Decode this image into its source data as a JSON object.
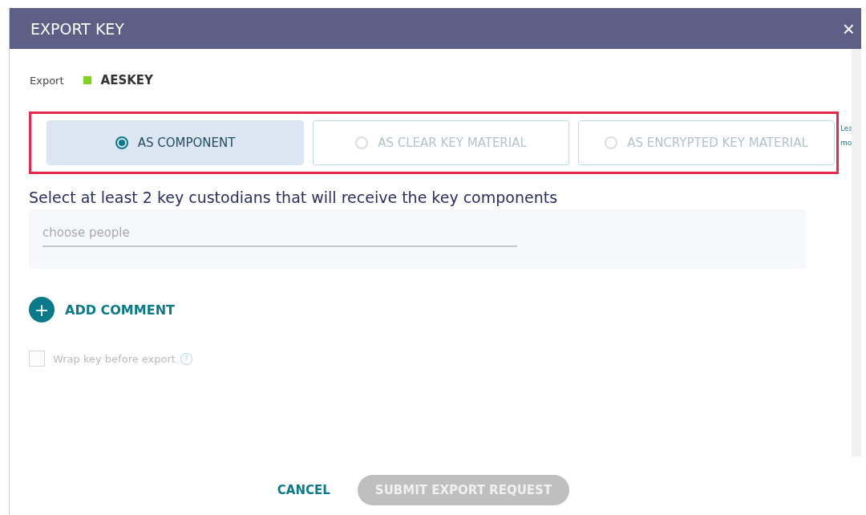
{
  "dialog": {
    "title": "EXPORT KEY",
    "close_icon": "×"
  },
  "export": {
    "label": "Export",
    "key_name": "AESKEY",
    "color": "#7ed321"
  },
  "options": [
    {
      "label": "AS COMPONENT",
      "selected": true
    },
    {
      "label": "AS CLEAR KEY MATERIAL",
      "selected": false
    },
    {
      "label": "AS ENCRYPTED KEY MATERIAL",
      "selected": false
    }
  ],
  "side_link": [
    "Lea",
    "mo"
  ],
  "custodians": {
    "heading": "Select at least 2 key custodians that will receive the key components",
    "placeholder": "choose people"
  },
  "add_comment": {
    "icon": "+",
    "label": "ADD COMMENT"
  },
  "wrap": {
    "label": "Wrap key before export",
    "checked": false,
    "disabled": true,
    "help_icon": "?"
  },
  "buttons": [
    {
      "kind": "link",
      "label": "CANCEL",
      "disabled": false
    },
    {
      "kind": "primary",
      "label": "SUBMIT EXPORT REQUEST",
      "disabled": true
    }
  ]
}
